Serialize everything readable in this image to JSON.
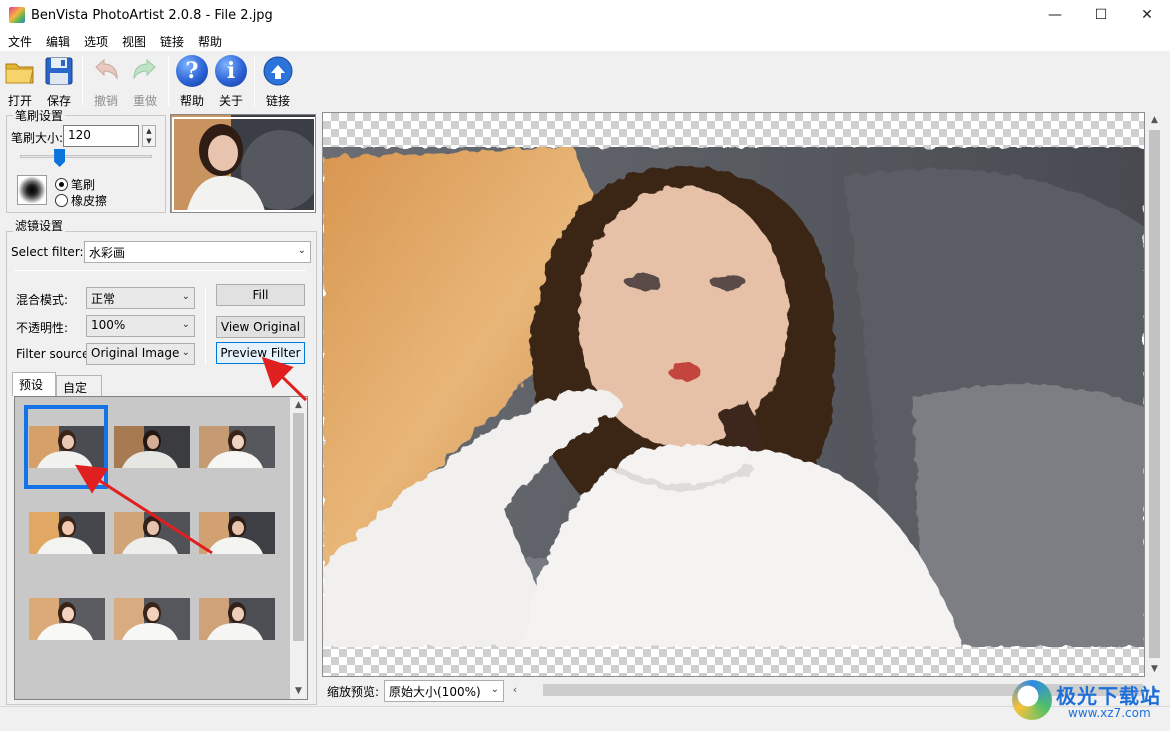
{
  "window": {
    "title": "BenVista PhotoArtist 2.0.8 - File 2.jpg",
    "minimize": "—",
    "maximize": "☐",
    "close": "✕"
  },
  "menu": [
    "文件",
    "编辑",
    "选项",
    "视图",
    "链接",
    "帮助"
  ],
  "toolbar": {
    "open": "打开",
    "save": "保存",
    "undo": "撤销",
    "redo": "重做",
    "help": "帮助",
    "about": "关于",
    "link": "链接"
  },
  "brush": {
    "group_label": "笔刷设置",
    "size_label": "笔刷大小:",
    "size_value": "120",
    "size_fraction": 0.3,
    "mode_brush": "笔刷",
    "mode_eraser": "橡皮擦"
  },
  "filter": {
    "group_label": "滤镜设置",
    "select_label": "Select filter:",
    "select_value": "水彩画",
    "blend_label": "混合模式:",
    "blend_value": "正常",
    "opacity_label": "不透明性:",
    "opacity_value": "100%",
    "source_label": "Filter source:",
    "source_value": "Original Image",
    "fill": "Fill",
    "view_original": "View Original",
    "preview_filter": "Preview Filter"
  },
  "tabs": {
    "preset": "预设",
    "custom": "自定义"
  },
  "zoom": {
    "label": "缩放预览:",
    "value": "原始大小(100%)"
  },
  "watermark": {
    "name": "极光下载站",
    "url": "www.xz7.com"
  },
  "colors": {
    "accent": "#0078d7",
    "annotation": "#e02020",
    "preset_selection": "#1473e6"
  }
}
